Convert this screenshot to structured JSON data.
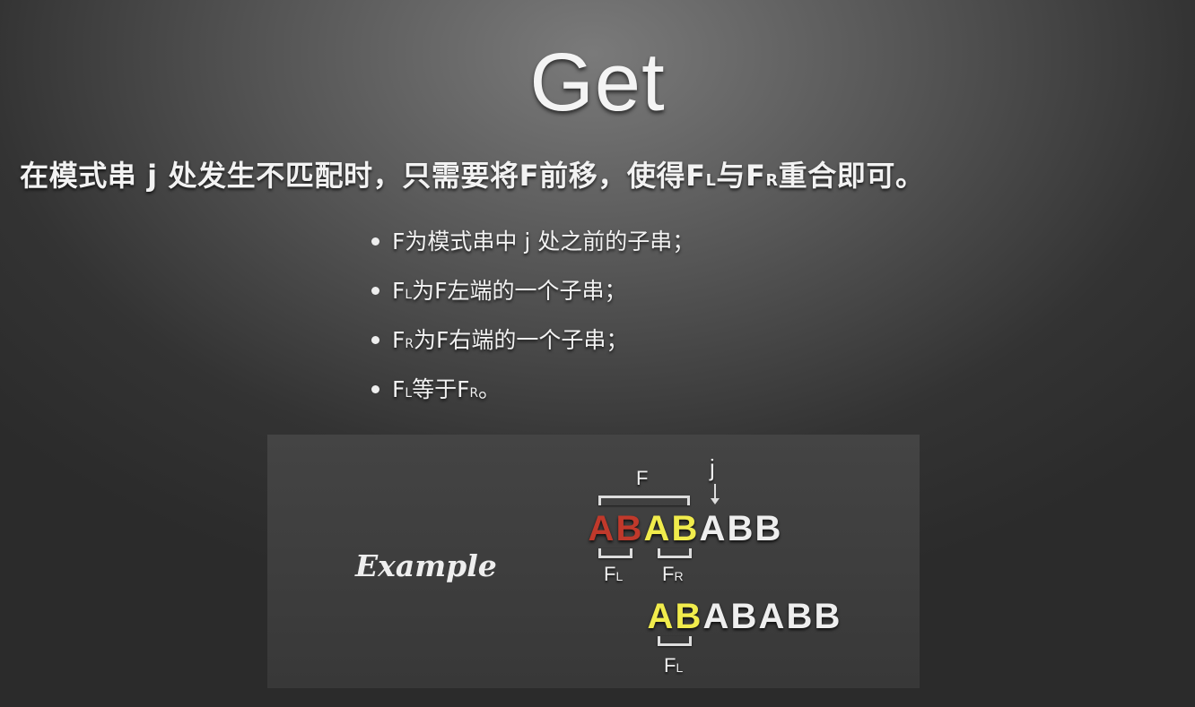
{
  "title": "Get",
  "subtitle": {
    "part1": "在模式串 j 处发生不匹配时，只需要将F前移，使得F",
    "sub1": "L",
    "part2": "与F",
    "sub2": "R",
    "part3": "重合即可。"
  },
  "bullets": [
    {
      "pre": "F为模式串中 j 处之前的子串；",
      "sub": "",
      "post": ""
    },
    {
      "pre": "F",
      "sub": "L",
      "post": "为F左端的一个子串；"
    },
    {
      "pre": "F",
      "sub": "R",
      "post": "为F右端的一个子串；"
    },
    {
      "pre": "F",
      "sub": "L",
      "post": "等于F",
      "sub2": "R",
      "post2": "。"
    }
  ],
  "example": {
    "label": "Example",
    "j_label": "j",
    "f_label": "F",
    "fl_label": {
      "main": "F",
      "sub": "L"
    },
    "fr_label": {
      "main": "F",
      "sub": "R"
    },
    "fl2_label": {
      "main": "F",
      "sub": "L"
    },
    "row1": [
      {
        "ch": "A",
        "color": "#c0392b"
      },
      {
        "ch": "B",
        "color": "#c0392b"
      },
      {
        "ch": "A",
        "color": "#f1ec4c"
      },
      {
        "ch": "B",
        "color": "#f1ec4c"
      },
      {
        "ch": "A",
        "color": "#eeeeee"
      },
      {
        "ch": "B",
        "color": "#eeeeee"
      },
      {
        "ch": "B",
        "color": "#eeeeee"
      }
    ],
    "row2": [
      {
        "ch": "A",
        "color": "#f1ec4c"
      },
      {
        "ch": "B",
        "color": "#f1ec4c"
      },
      {
        "ch": "A",
        "color": "#eeeeee"
      },
      {
        "ch": "B",
        "color": "#eeeeee"
      },
      {
        "ch": "A",
        "color": "#eeeeee"
      },
      {
        "ch": "B",
        "color": "#eeeeee"
      },
      {
        "ch": "B",
        "color": "#eeeeee"
      }
    ]
  }
}
